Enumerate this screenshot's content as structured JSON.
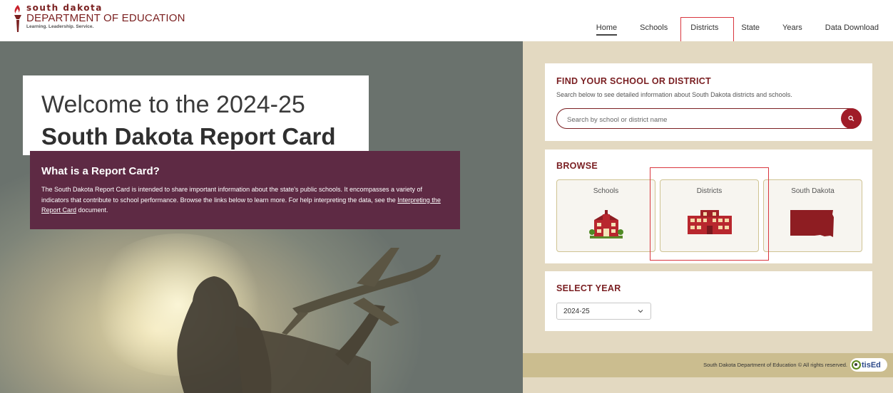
{
  "header": {
    "logo": {
      "line1": "south dakota",
      "line2": "DEPARTMENT OF EDUCATION",
      "tagline": "Learning. Leadership. Service."
    },
    "nav": [
      {
        "label": "Home",
        "active": true
      },
      {
        "label": "Schools",
        "active": false
      },
      {
        "label": "Districts",
        "active": false,
        "highlighted": true
      },
      {
        "label": "State",
        "active": false
      },
      {
        "label": "Years",
        "active": false
      },
      {
        "label": "Data Download",
        "active": false
      }
    ]
  },
  "hero": {
    "welcome_line1": "Welcome to the 2024-25",
    "welcome_line2": "South Dakota Report Card",
    "report_card": {
      "title": "What is a Report Card?",
      "text_before_link": "The South Dakota Report Card is intended to share important information about the state's public schools. It encompasses a variety of indicators that contribute to school performance. Browse the links below to learn more. For help interpreting the data, see the ",
      "link_text": "Interpreting the Report Card",
      "text_after_link": " document."
    }
  },
  "find": {
    "title": "FIND YOUR SCHOOL OR DISTRICT",
    "subtitle": "Search below to see detailed information about South Dakota districts and schools.",
    "placeholder": "Search by school or district name"
  },
  "browse": {
    "title": "BROWSE",
    "tiles": [
      {
        "label": "Schools",
        "icon": "school-building-icon"
      },
      {
        "label": "Districts",
        "icon": "district-building-icon",
        "highlighted": true
      },
      {
        "label": "South Dakota",
        "icon": "south-dakota-map-icon"
      }
    ]
  },
  "select_year": {
    "title": "SELECT YEAR",
    "value": "2024-25"
  },
  "footer": {
    "copyright": "South Dakota Department of Education © All rights reserved.",
    "brand": "tisEd"
  },
  "colors": {
    "maroon": "#7a1f22",
    "plum": "#5e2a44",
    "search_button": "#a01c28",
    "panel_bg": "#e3d9c1",
    "footer_bg": "#cbbd8f",
    "highlight": "#d9363e"
  }
}
